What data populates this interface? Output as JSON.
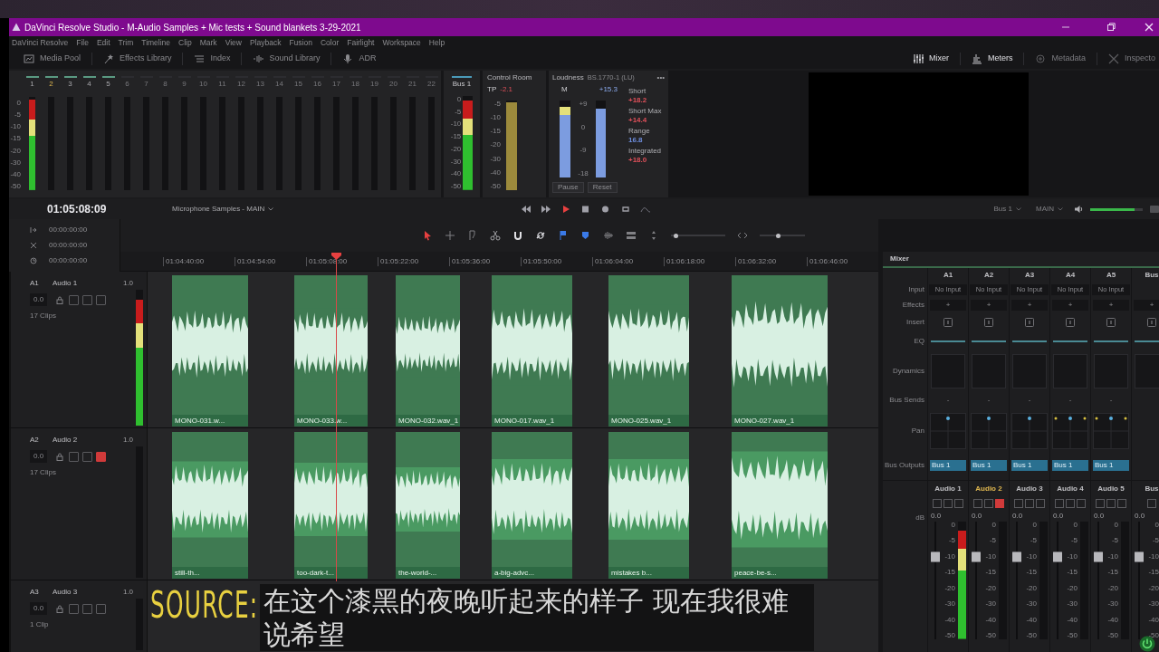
{
  "window": {
    "title": "DaVinci Resolve Studio - M-Audio Samples + Mic tests + Sound blankets 3-29-2021"
  },
  "menu": [
    "DaVinci Resolve",
    "File",
    "Edit",
    "Trim",
    "Timeline",
    "Clip",
    "Mark",
    "View",
    "Playback",
    "Fusion",
    "Color",
    "Fairlight",
    "Workspace",
    "Help"
  ],
  "toolbar_left": [
    {
      "kind": "media",
      "label": "Media Pool"
    },
    {
      "kind": "effects",
      "label": "Effects Library"
    },
    {
      "kind": "index",
      "label": "Index"
    },
    {
      "kind": "sound",
      "label": "Sound Library"
    },
    {
      "kind": "adr",
      "label": "ADR"
    }
  ],
  "toolbar_right": [
    {
      "kind": "mixer",
      "label": "Mixer",
      "on": true
    },
    {
      "kind": "meters",
      "label": "Meters",
      "on": true
    },
    {
      "kind": "metadata",
      "label": "Metadata",
      "on": false
    },
    {
      "kind": "inspector",
      "label": "Inspecto",
      "on": false
    }
  ],
  "meters": {
    "scale": [
      "0",
      "-5",
      "-10",
      "-15",
      "-20",
      "-30",
      "-40",
      "-50"
    ],
    "channels": [
      {
        "label": "1",
        "active": true,
        "selected": false,
        "level": 0.97
      },
      {
        "label": "2",
        "active": true,
        "selected": true
      },
      {
        "label": "3",
        "active": true,
        "selected": false
      },
      {
        "label": "4",
        "active": true,
        "selected": false
      },
      {
        "label": "5",
        "active": true,
        "selected": false
      },
      {
        "label": "6",
        "active": false,
        "selected": false
      },
      {
        "label": "7",
        "active": false,
        "selected": false
      },
      {
        "label": "8",
        "active": false,
        "selected": false
      },
      {
        "label": "9",
        "active": false,
        "selected": false
      },
      {
        "label": "10",
        "active": false,
        "selected": false
      },
      {
        "label": "11",
        "active": false,
        "selected": false
      },
      {
        "label": "12",
        "active": false,
        "selected": false
      },
      {
        "label": "13",
        "active": false,
        "selected": false
      },
      {
        "label": "14",
        "active": false,
        "selected": false
      },
      {
        "label": "15",
        "active": false,
        "selected": false
      },
      {
        "label": "16",
        "active": false,
        "selected": false
      },
      {
        "label": "17",
        "active": false,
        "selected": false
      },
      {
        "label": "18",
        "active": false,
        "selected": false
      },
      {
        "label": "19",
        "active": false,
        "selected": false
      },
      {
        "label": "20",
        "active": false,
        "selected": false
      },
      {
        "label": "21",
        "active": false,
        "selected": false
      },
      {
        "label": "22",
        "active": false,
        "selected": false
      }
    ]
  },
  "bus": {
    "label": "Bus 1",
    "level": 0.95,
    "scale": [
      "0",
      "-5",
      "-10",
      "-15",
      "-20",
      "-30",
      "-40",
      "-50"
    ]
  },
  "control_room": {
    "title": "Control Room",
    "tp_label": "TP",
    "tp_reading": "-2.1",
    "level": 0.98,
    "scale": [
      "-5",
      "-10",
      "-15",
      "-20",
      "-30",
      "-40",
      "-50"
    ]
  },
  "loudness": {
    "title": "Loudness",
    "standard": "BS.1770-1 (LU)",
    "menu": "•••",
    "m_label": "M",
    "m_meter": {
      "level": 0.92
    },
    "reading": "+15.3",
    "reading_meter": {
      "level": 0.9
    },
    "scale": [
      "+9",
      "0",
      "-9",
      "-18"
    ],
    "stats": [
      {
        "label": "Short",
        "value": "+18.2",
        "color": "#e0505a"
      },
      {
        "label": "Short Max",
        "value": "+14.4",
        "color": "#e0505a"
      },
      {
        "label": "Range",
        "value": "16.8",
        "color": "#6f8fe0"
      },
      {
        "label": "Integrated",
        "value": "+18.0",
        "color": "#e0505a"
      }
    ],
    "buttons": [
      "Pause",
      "Reset"
    ]
  },
  "timeline": {
    "timecode": "01:05:08:09",
    "name": "Microphone Samples - MAIN",
    "output_bus": "Bus 1",
    "output_main": "MAIN",
    "volume": {
      "level": 0.85
    },
    "zoom_sliders": [
      {
        "level": 0.08
      },
      {
        "level": 0.4
      }
    ],
    "timecodes": [
      "00:00:00:00",
      "00:00:00:00",
      "00:00:00:00"
    ],
    "ruler": [
      "01:04:40:00",
      "01:04:54:00",
      "01:05:08:00",
      "01:05:22:00",
      "01:05:36:00",
      "01:05:50:00",
      "01:06:04:00",
      "01:06:18:00",
      "01:06:32:00",
      "01:06:46:00"
    ]
  },
  "tracks": [
    {
      "id": "A1",
      "name": "Audio 1",
      "volume": "1.0",
      "pan": "0.0",
      "muted": false,
      "clip_count": "17 Clips",
      "level": 0.93,
      "clips": [
        "MONO-031.w...",
        "MONO-033.w...",
        "MONO-032.wav_1",
        "MONO-017.wav_1",
        "MONO-025.wav_1",
        "MONO-027.wav_1"
      ]
    },
    {
      "id": "A2",
      "name": "Audio 2",
      "volume": "1.0",
      "pan": "0.0",
      "muted": true,
      "clip_count": "17 Clips",
      "clips": [
        "still-th...",
        "too-dark-t...",
        "the-world-...",
        "a-big-advc...",
        "mistakes b...",
        "peace-be-s..."
      ]
    },
    {
      "id": "A3",
      "name": "Audio 3",
      "volume": "1.0",
      "pan": "0.0",
      "muted": false,
      "clip_count": "1 Clip"
    }
  ],
  "mixer": {
    "title": "Mixer",
    "row_labels": [
      "Input",
      "Effects",
      "Insert",
      "EQ",
      "Dynamics",
      "Bus Sends",
      "Pan",
      "Bus Outputs"
    ],
    "db_label": "dB",
    "channels": [
      {
        "kind": "track",
        "header": "A1",
        "input": "No Input",
        "effects": "+",
        "sends": "-",
        "stereo": false,
        "output": "Bus 1",
        "name": "Audio 1",
        "selected": false,
        "muted": false,
        "value": "0.0",
        "fader": {
          "level": 0.7
        },
        "level": 0.92,
        "scale": [
          "0",
          "-5",
          "-10",
          "-15",
          "-20",
          "-30",
          "-40",
          "-50"
        ]
      },
      {
        "kind": "track",
        "header": "A2",
        "input": "No Input",
        "effects": "+",
        "sends": "-",
        "stereo": false,
        "output": "Bus 1",
        "name": "Audio 2",
        "selected": true,
        "muted": true,
        "value": "0.0",
        "fader": {
          "level": 0.7
        },
        "scale": [
          "0",
          "-5",
          "-10",
          "-15",
          "-20",
          "-30",
          "-40",
          "-50"
        ]
      },
      {
        "kind": "track",
        "header": "A3",
        "input": "No Input",
        "effects": "+",
        "sends": "-",
        "stereo": false,
        "output": "Bus 1",
        "name": "Audio 3",
        "selected": false,
        "muted": false,
        "value": "0.0",
        "fader": {
          "level": 0.7
        },
        "scale": [
          "0",
          "-5",
          "-10",
          "-15",
          "-20",
          "-30",
          "-40",
          "-50"
        ]
      },
      {
        "kind": "track",
        "header": "A4",
        "input": "No Input",
        "effects": "+",
        "sends": "-",
        "stereo": true,
        "output": "Bus 1",
        "name": "Audio 4",
        "selected": false,
        "muted": false,
        "value": "0.0",
        "fader": {
          "level": 0.7
        },
        "scale": [
          "0",
          "-5",
          "-10",
          "-15",
          "-20",
          "-30",
          "-40",
          "-50"
        ]
      },
      {
        "kind": "track",
        "header": "A5",
        "input": "No Input",
        "effects": "+",
        "sends": "-",
        "stereo": true,
        "output": "Bus 1",
        "name": "Audio 5",
        "selected": false,
        "muted": false,
        "value": "0.0",
        "fader": {
          "level": 0.7
        },
        "scale": [
          "0",
          "-5",
          "-10",
          "-15",
          "-20",
          "-30",
          "-40",
          "-50"
        ]
      },
      {
        "kind": "bus",
        "header": "Bus",
        "effects": "+",
        "name": "Bus",
        "selected": false,
        "muted": false,
        "value": "0.0",
        "fader": {
          "level": 0.7
        },
        "scale": [
          "0",
          "-5",
          "-10",
          "-15",
          "-20",
          "-30",
          "-40",
          "-50"
        ]
      }
    ]
  },
  "overlay": {
    "source_label": "SOURCE:",
    "subtitle": "在这个漆黑的夜晚听起来的样子 现在我很难说希望"
  }
}
